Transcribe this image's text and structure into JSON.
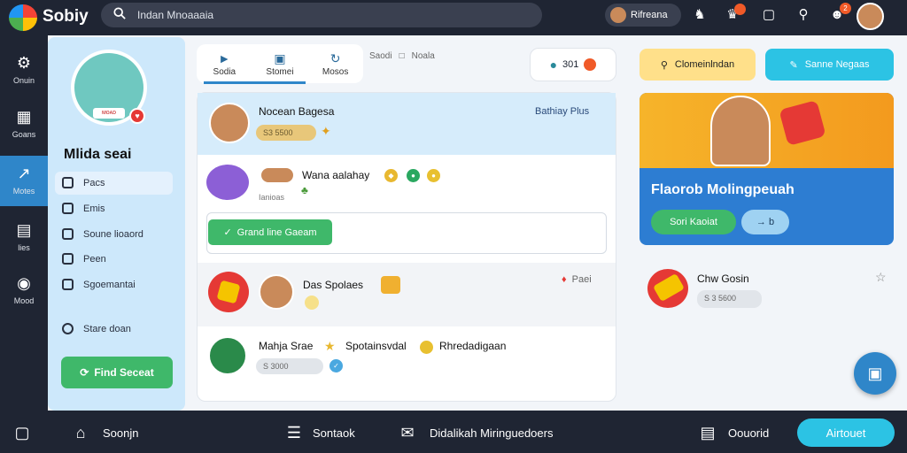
{
  "app": {
    "brand": "Sobiy"
  },
  "search": {
    "value": "Indan Mnoaaaia"
  },
  "topbar": {
    "user_name": "Rifreana",
    "badges": [
      "",
      "",
      "2"
    ]
  },
  "rail": {
    "items": [
      {
        "label": "Onuin",
        "icon": "gear-icon"
      },
      {
        "label": "Goans",
        "icon": "chart-icon"
      },
      {
        "label": "Motes",
        "icon": "share-icon"
      },
      {
        "label": "lies",
        "icon": "book-icon"
      },
      {
        "label": "Mood",
        "icon": "chat-icon"
      }
    ]
  },
  "profile": {
    "name": "Mlida seai",
    "badge": "ᴍᴏᴀᴅ",
    "items": [
      "Pacs",
      "Emis",
      "Soune lioaord",
      "Peen",
      "Sgoemantai",
      "Stare doan"
    ],
    "find_button": "Find Seceat"
  },
  "tabs": {
    "items": [
      "Sodia",
      "Stomei",
      "Mosos"
    ],
    "extra": [
      "Saodi",
      "Noala"
    ]
  },
  "counter": {
    "value": "301"
  },
  "feed": {
    "post1": {
      "name": "Nocean Bagesa",
      "tag": "Bathiay Plus",
      "pill": "S3 5500"
    },
    "post2": {
      "name": "Wana aalahay",
      "sub": "Ianioas"
    },
    "grand_button": "Grand line Gaeam",
    "post3": {
      "name": "Das Spolaes",
      "tag": "Paei"
    },
    "post4": {
      "name": "Mahja Srae",
      "extra1": "Spotainsvdal",
      "extra2": "Rhredadigaan",
      "pill": "S 3000"
    }
  },
  "right": {
    "btn_yellow": "Clomeinlndan",
    "btn_blue": "Sanne Negaas",
    "banner": {
      "title": "Flaorob Molingpeuah",
      "btn1": "Sori Kaoiat",
      "btn2": "→ b"
    },
    "card": {
      "name": "Chw Gosin",
      "pill": "S 3 5600"
    }
  },
  "bottom": {
    "items": [
      "Soonjn",
      "Sontaok",
      "Didalikah Miringuedoers",
      "Oouorid"
    ],
    "about": "Airtouet"
  },
  "colors": {
    "accent": "#2f86c9",
    "green": "#3fb86a",
    "cyan": "#2cc3e4",
    "dark": "#1f2533"
  }
}
